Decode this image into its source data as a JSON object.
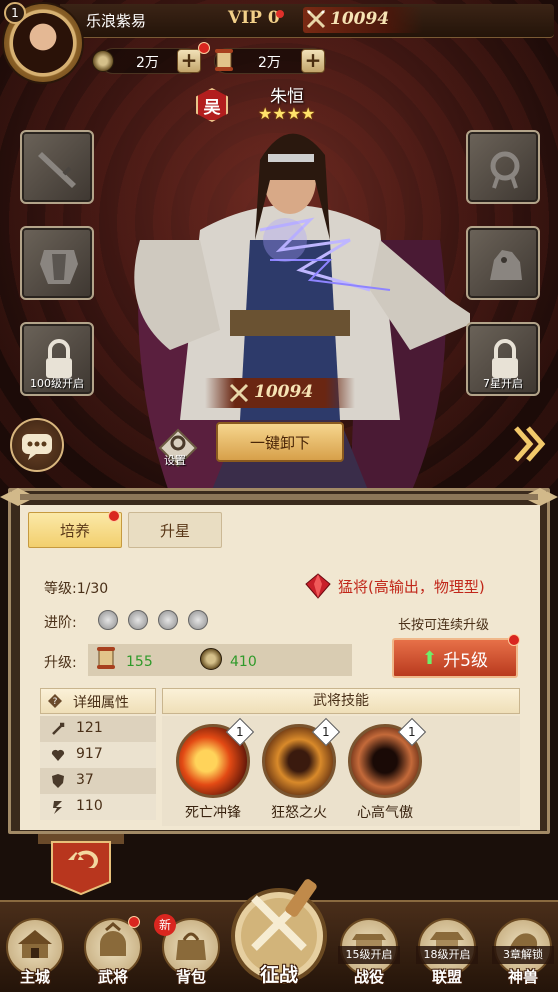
{
  "header": {
    "player_level": "1",
    "player_name": "乐浪紫易",
    "vip": "VIP 0",
    "power": "10094",
    "coins": "2万",
    "scrolls": "2万"
  },
  "hero": {
    "kingdom": "吴",
    "name": "朱恒",
    "stars": "★★★★",
    "power": "10094"
  },
  "equipment": {
    "slot_locked_left_label": "100级开启",
    "slot_locked_right_label": "7星开启"
  },
  "actions": {
    "settings_label": "设置",
    "unequip_all_label": "一键卸下"
  },
  "panel": {
    "tabs": [
      "培养",
      "升星"
    ],
    "level_text": "等级:1/30",
    "hero_type": "猛将(高输出，物理型)",
    "advance_label": "进阶:",
    "upgrade_label": "升级:",
    "cost_scroll": "155",
    "cost_coin": "410",
    "hold_hint": "长按可连续升级",
    "upgrade_button": "升5级",
    "attr_header": "详细属性",
    "attrs": [
      "121",
      "917",
      "37",
      "110"
    ],
    "skills_header": "武将技能",
    "skills": [
      {
        "name": "死亡冲锋",
        "level": "1"
      },
      {
        "name": "狂怒之火",
        "level": "1"
      },
      {
        "name": "心高气傲",
        "level": "1"
      }
    ]
  },
  "nav": {
    "items": [
      "主城",
      "武将",
      "背包",
      "征战",
      "战役",
      "联盟",
      "神兽"
    ],
    "new_badge": "新",
    "locks": [
      "15级开启",
      "18级开启",
      "3章解锁"
    ]
  }
}
